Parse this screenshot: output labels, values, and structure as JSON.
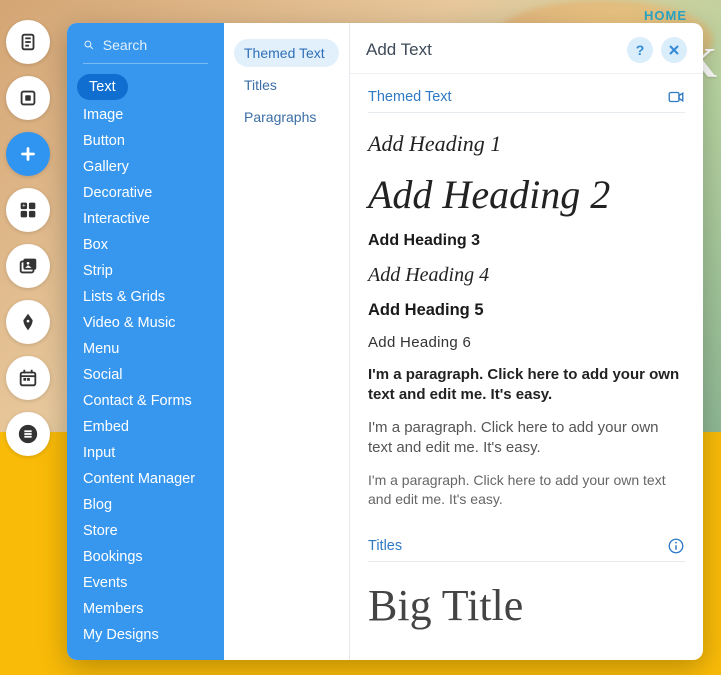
{
  "bg": {
    "home_link": "HOME",
    "side_letter": "K"
  },
  "rail": {
    "items": [
      {
        "name": "pages-icon",
        "active": false
      },
      {
        "name": "background-icon",
        "active": false
      },
      {
        "name": "add-icon",
        "active": true
      },
      {
        "name": "apps-icon",
        "active": false
      },
      {
        "name": "media-icon",
        "active": false
      },
      {
        "name": "pen-icon",
        "active": false
      },
      {
        "name": "calendar-icon",
        "active": false
      },
      {
        "name": "list-icon",
        "active": false
      }
    ]
  },
  "search": {
    "placeholder": "Search"
  },
  "categories": [
    "Text",
    "Image",
    "Button",
    "Gallery",
    "Decorative",
    "Interactive",
    "Box",
    "Strip",
    "Lists & Grids",
    "Video & Music",
    "Menu",
    "Social",
    "Contact & Forms",
    "Embed",
    "Input",
    "Content Manager",
    "Blog",
    "Store",
    "Bookings",
    "Events",
    "Members",
    "My Designs"
  ],
  "categories_selected_index": 0,
  "subcategories": [
    "Themed Text",
    "Titles",
    "Paragraphs"
  ],
  "subcategories_selected_index": 0,
  "header": {
    "title": "Add Text",
    "help": "?",
    "close": "×"
  },
  "sections": {
    "themed": {
      "label": "Themed Text",
      "items": {
        "h1": "Add Heading 1",
        "h2": "Add Heading 2",
        "h3": "Add Heading 3",
        "h4": "Add Heading 4",
        "h5": "Add Heading 5",
        "h6": "Add Heading 6",
        "p1": "I'm a paragraph. Click here to add your own text and edit me. It's easy.",
        "p2": "I'm a paragraph. Click here to add your own text and edit me. It's easy.",
        "p3": "I'm a paragraph. Click here to add your own text and edit me. It's easy."
      }
    },
    "titles": {
      "label": "Titles",
      "big": "Big Title"
    }
  }
}
